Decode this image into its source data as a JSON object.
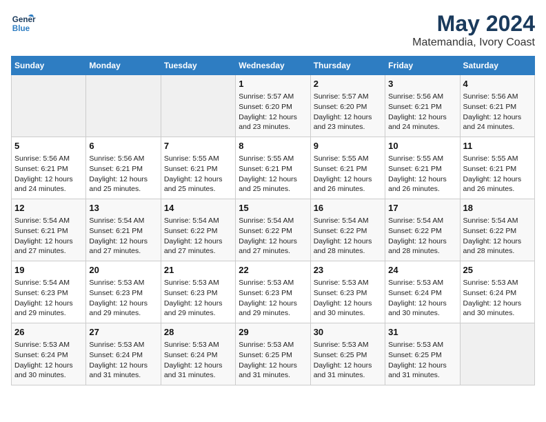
{
  "header": {
    "logo_general": "General",
    "logo_blue": "Blue",
    "title": "May 2024",
    "subtitle": "Matemandia, Ivory Coast"
  },
  "weekdays": [
    "Sunday",
    "Monday",
    "Tuesday",
    "Wednesday",
    "Thursday",
    "Friday",
    "Saturday"
  ],
  "weeks": [
    [
      {
        "day": "",
        "info": ""
      },
      {
        "day": "",
        "info": ""
      },
      {
        "day": "",
        "info": ""
      },
      {
        "day": "1",
        "info": "Sunrise: 5:57 AM\nSunset: 6:20 PM\nDaylight: 12 hours\nand 23 minutes."
      },
      {
        "day": "2",
        "info": "Sunrise: 5:57 AM\nSunset: 6:20 PM\nDaylight: 12 hours\nand 23 minutes."
      },
      {
        "day": "3",
        "info": "Sunrise: 5:56 AM\nSunset: 6:21 PM\nDaylight: 12 hours\nand 24 minutes."
      },
      {
        "day": "4",
        "info": "Sunrise: 5:56 AM\nSunset: 6:21 PM\nDaylight: 12 hours\nand 24 minutes."
      }
    ],
    [
      {
        "day": "5",
        "info": "Sunrise: 5:56 AM\nSunset: 6:21 PM\nDaylight: 12 hours\nand 24 minutes."
      },
      {
        "day": "6",
        "info": "Sunrise: 5:56 AM\nSunset: 6:21 PM\nDaylight: 12 hours\nand 25 minutes."
      },
      {
        "day": "7",
        "info": "Sunrise: 5:55 AM\nSunset: 6:21 PM\nDaylight: 12 hours\nand 25 minutes."
      },
      {
        "day": "8",
        "info": "Sunrise: 5:55 AM\nSunset: 6:21 PM\nDaylight: 12 hours\nand 25 minutes."
      },
      {
        "day": "9",
        "info": "Sunrise: 5:55 AM\nSunset: 6:21 PM\nDaylight: 12 hours\nand 26 minutes."
      },
      {
        "day": "10",
        "info": "Sunrise: 5:55 AM\nSunset: 6:21 PM\nDaylight: 12 hours\nand 26 minutes."
      },
      {
        "day": "11",
        "info": "Sunrise: 5:55 AM\nSunset: 6:21 PM\nDaylight: 12 hours\nand 26 minutes."
      }
    ],
    [
      {
        "day": "12",
        "info": "Sunrise: 5:54 AM\nSunset: 6:21 PM\nDaylight: 12 hours\nand 27 minutes."
      },
      {
        "day": "13",
        "info": "Sunrise: 5:54 AM\nSunset: 6:21 PM\nDaylight: 12 hours\nand 27 minutes."
      },
      {
        "day": "14",
        "info": "Sunrise: 5:54 AM\nSunset: 6:22 PM\nDaylight: 12 hours\nand 27 minutes."
      },
      {
        "day": "15",
        "info": "Sunrise: 5:54 AM\nSunset: 6:22 PM\nDaylight: 12 hours\nand 27 minutes."
      },
      {
        "day": "16",
        "info": "Sunrise: 5:54 AM\nSunset: 6:22 PM\nDaylight: 12 hours\nand 28 minutes."
      },
      {
        "day": "17",
        "info": "Sunrise: 5:54 AM\nSunset: 6:22 PM\nDaylight: 12 hours\nand 28 minutes."
      },
      {
        "day": "18",
        "info": "Sunrise: 5:54 AM\nSunset: 6:22 PM\nDaylight: 12 hours\nand 28 minutes."
      }
    ],
    [
      {
        "day": "19",
        "info": "Sunrise: 5:54 AM\nSunset: 6:23 PM\nDaylight: 12 hours\nand 29 minutes."
      },
      {
        "day": "20",
        "info": "Sunrise: 5:53 AM\nSunset: 6:23 PM\nDaylight: 12 hours\nand 29 minutes."
      },
      {
        "day": "21",
        "info": "Sunrise: 5:53 AM\nSunset: 6:23 PM\nDaylight: 12 hours\nand 29 minutes."
      },
      {
        "day": "22",
        "info": "Sunrise: 5:53 AM\nSunset: 6:23 PM\nDaylight: 12 hours\nand 29 minutes."
      },
      {
        "day": "23",
        "info": "Sunrise: 5:53 AM\nSunset: 6:23 PM\nDaylight: 12 hours\nand 30 minutes."
      },
      {
        "day": "24",
        "info": "Sunrise: 5:53 AM\nSunset: 6:24 PM\nDaylight: 12 hours\nand 30 minutes."
      },
      {
        "day": "25",
        "info": "Sunrise: 5:53 AM\nSunset: 6:24 PM\nDaylight: 12 hours\nand 30 minutes."
      }
    ],
    [
      {
        "day": "26",
        "info": "Sunrise: 5:53 AM\nSunset: 6:24 PM\nDaylight: 12 hours\nand 30 minutes."
      },
      {
        "day": "27",
        "info": "Sunrise: 5:53 AM\nSunset: 6:24 PM\nDaylight: 12 hours\nand 31 minutes."
      },
      {
        "day": "28",
        "info": "Sunrise: 5:53 AM\nSunset: 6:24 PM\nDaylight: 12 hours\nand 31 minutes."
      },
      {
        "day": "29",
        "info": "Sunrise: 5:53 AM\nSunset: 6:25 PM\nDaylight: 12 hours\nand 31 minutes."
      },
      {
        "day": "30",
        "info": "Sunrise: 5:53 AM\nSunset: 6:25 PM\nDaylight: 12 hours\nand 31 minutes."
      },
      {
        "day": "31",
        "info": "Sunrise: 5:53 AM\nSunset: 6:25 PM\nDaylight: 12 hours\nand 31 minutes."
      },
      {
        "day": "",
        "info": ""
      }
    ]
  ]
}
